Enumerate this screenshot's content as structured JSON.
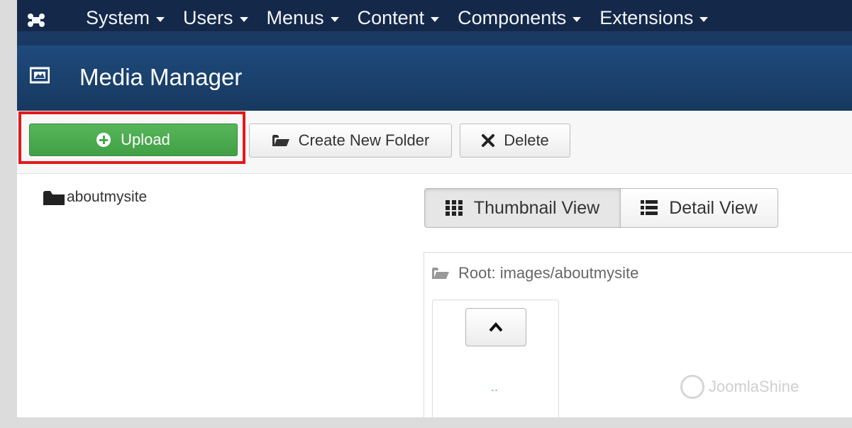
{
  "nav": {
    "items": [
      "System",
      "Users",
      "Menus",
      "Content",
      "Components",
      "Extensions"
    ]
  },
  "header": {
    "title": "Media Manager"
  },
  "toolbar": {
    "upload_label": "Upload",
    "create_folder_label": "Create New Folder",
    "delete_label": "Delete"
  },
  "tree": {
    "folder_label": "aboutmysite"
  },
  "view_toggle": {
    "thumbnail_label": "Thumbnail View",
    "detail_label": "Detail View",
    "active": "Thumbnail View"
  },
  "browser": {
    "path_label": "Root: images/aboutmysite",
    "up_item_label": ".."
  },
  "watermark": {
    "text": "JoomlaShine"
  },
  "colors": {
    "nav_bg": "#142849",
    "header_bg": "#1f4a7d",
    "upload_green": "#48a84b",
    "highlight_red": "#e3191b"
  },
  "icons": {
    "logo": "joomla-logo-icon",
    "header": "image-icon",
    "upload": "plus-circle-icon",
    "create_folder": "folder-open-icon",
    "delete": "x-icon",
    "tree_folder": "folder-icon",
    "thumbnail": "grid-icon",
    "detail": "list-icon",
    "path": "folder-open-icon",
    "up": "chevron-up-icon"
  }
}
